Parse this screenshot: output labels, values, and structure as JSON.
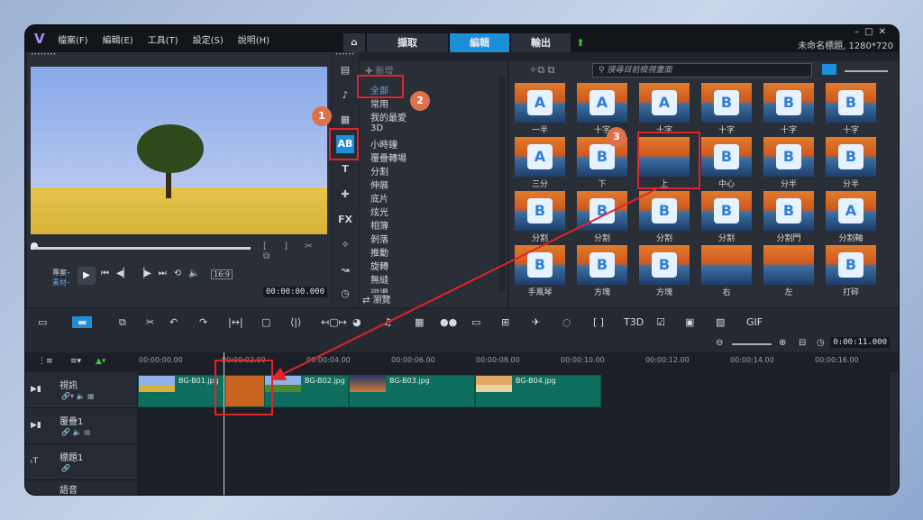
{
  "menu": [
    "檔案(F)",
    "編輯(E)",
    "工具(T)",
    "設定(S)",
    "說明(H)"
  ],
  "tabs": {
    "capture": "擷取",
    "edit": "編輯",
    "output": "輸出"
  },
  "window": {
    "project_title": "未命名標題, 1280*720"
  },
  "player": {
    "mode_project": "專案–",
    "mode_clip": "素材–",
    "aspect": "16:9",
    "timecode": "00:00:00.000"
  },
  "library": {
    "new_label": "新增",
    "categories": [
      "全部",
      "常用",
      "我的最愛",
      "3D",
      "小時鐘",
      "覆疊轉場",
      "分割",
      "伸展",
      "底片",
      "炫光",
      "相簿",
      "剝落",
      "推動",
      "旋轉",
      "無縫",
      "迴盪"
    ],
    "browse": "瀏覽",
    "search_placeholder": "搜尋目前檢視畫面"
  },
  "transitions": [
    {
      "label": "一半",
      "glyph": "A"
    },
    {
      "label": "十字",
      "glyph": "A"
    },
    {
      "label": "十字",
      "glyph": "A"
    },
    {
      "label": "十字",
      "glyph": "B"
    },
    {
      "label": "十字",
      "glyph": "B"
    },
    {
      "label": "十字",
      "glyph": "B"
    },
    {
      "label": "三分",
      "glyph": "A"
    },
    {
      "label": "下",
      "glyph": "B"
    },
    {
      "label": "上",
      "glyph": ""
    },
    {
      "label": "中心",
      "glyph": "B"
    },
    {
      "label": "分半",
      "glyph": "B"
    },
    {
      "label": "分半",
      "glyph": "B"
    },
    {
      "label": "分割",
      "glyph": "B"
    },
    {
      "label": "分割",
      "glyph": "B"
    },
    {
      "label": "分割",
      "glyph": "B"
    },
    {
      "label": "分割",
      "glyph": "B"
    },
    {
      "label": "分割門",
      "glyph": "B"
    },
    {
      "label": "分割軸",
      "glyph": "A"
    },
    {
      "label": "手風琴",
      "glyph": "B"
    },
    {
      "label": "方塊",
      "glyph": "B"
    },
    {
      "label": "方塊",
      "glyph": "B"
    },
    {
      "label": "右",
      "glyph": ""
    },
    {
      "label": "左",
      "glyph": ""
    },
    {
      "label": "打碎",
      "glyph": "B"
    }
  ],
  "timeline": {
    "timecode": "0:00:11.000",
    "ruler": [
      "00:00:00.00",
      "00:00:02.00",
      "00:00:04.00",
      "00:00:06.00",
      "00:00:08.00",
      "00:00:10.00",
      "00:00:12.00",
      "00:00:14.00",
      "00:00:16.00"
    ],
    "tracks": [
      "視訊",
      "覆疊1",
      "標題1",
      "語音"
    ],
    "clips": [
      "BG-B01.jpg",
      "BG-B02.jpg",
      "BG-B03.jpg",
      "BG-B04.jpg"
    ]
  },
  "annotations": [
    "1",
    "2",
    "3"
  ],
  "colors": {
    "accent": "#1d8fd9",
    "highlight": "#e0242a",
    "badge": "#e0714e",
    "clip": "#0f6f5e"
  }
}
